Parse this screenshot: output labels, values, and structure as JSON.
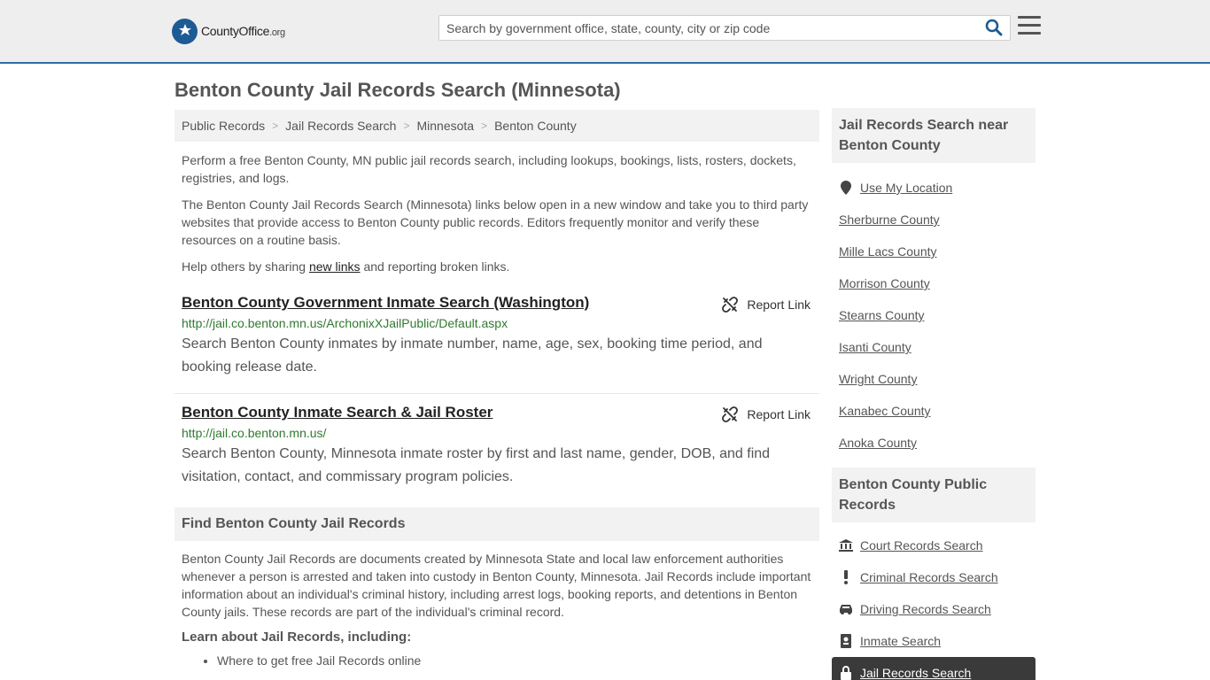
{
  "header": {
    "logo_main": "CountyOffice",
    "logo_tld": ".org",
    "search_placeholder": "Search by government office, state, county, city or zip code"
  },
  "page_title": "Benton County Jail Records Search (Minnesota)",
  "breadcrumb": [
    "Public Records",
    "Jail Records Search",
    "Minnesota",
    "Benton County"
  ],
  "intro": {
    "p1": "Perform a free Benton County, MN public jail records search, including lookups, bookings, lists, rosters, dockets, registries, and logs.",
    "p2": "The Benton County Jail Records Search (Minnesota) links below open in a new window and take you to third party websites that provide access to Benton County public records. Editors frequently monitor and verify these resources on a routine basis.",
    "p3_before": "Help others by sharing ",
    "p3_link": "new links",
    "p3_after": " and reporting broken links."
  },
  "links": [
    {
      "title": "Benton County Government Inmate Search (Washington)",
      "url": "http://jail.co.benton.mn.us/ArchonixXJailPublic/Default.aspx",
      "desc": "Search Benton County inmates by inmate number, name, age, sex, booking time period, and booking release date.",
      "report": "Report Link"
    },
    {
      "title": "Benton County Inmate Search & Jail Roster",
      "url": "http://jail.co.benton.mn.us/",
      "desc": "Search Benton County, Minnesota inmate roster by first and last name, gender, DOB, and find visitation, contact, and commissary program policies.",
      "report": "Report Link"
    }
  ],
  "find_section": {
    "heading": "Find Benton County Jail Records",
    "text": "Benton County Jail Records are documents created by Minnesota State and local law enforcement authorities whenever a person is arrested and taken into custody in Benton County, Minnesota. Jail Records include important information about an individual's criminal history, including arrest logs, booking reports, and detentions in Benton County jails. These records are part of the individual's criminal record.",
    "learn_heading": "Learn about Jail Records, including:",
    "learn_items": [
      "Where to get free Jail Records online"
    ]
  },
  "sidebar": {
    "nearby_heading": "Jail Records Search near Benton County",
    "use_location": "Use My Location",
    "nearby": [
      "Sherburne County",
      "Mille Lacs County",
      "Morrison County",
      "Stearns County",
      "Isanti County",
      "Wright County",
      "Kanabec County",
      "Anoka County"
    ],
    "public_heading": "Benton County Public Records",
    "public_records": [
      {
        "label": "Court Records Search",
        "icon": "courthouse-icon"
      },
      {
        "label": "Criminal Records Search",
        "icon": "exclamation-icon"
      },
      {
        "label": "Driving Records Search",
        "icon": "car-icon"
      },
      {
        "label": "Inmate Search",
        "icon": "id-badge-icon"
      },
      {
        "label": "Jail Records Search",
        "icon": "lock-icon"
      }
    ]
  },
  "colors": {
    "header_bg": "#eeeeee",
    "header_border": "#2e6ea6",
    "url_green": "#2f7a2f",
    "active_bg": "#3a3a3a"
  }
}
